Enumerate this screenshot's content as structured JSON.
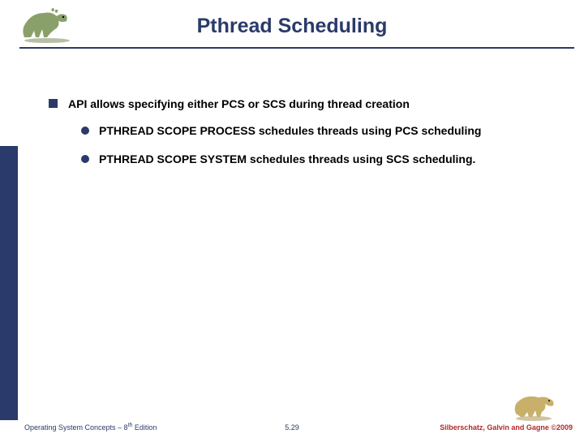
{
  "title": "Pthread Scheduling",
  "bullets": {
    "main": "API allows specifying either PCS or SCS during thread creation",
    "sub1": "PTHREAD SCOPE PROCESS schedules threads using PCS scheduling",
    "sub2": "PTHREAD SCOPE SYSTEM schedules threads using SCS scheduling."
  },
  "footer": {
    "left_a": "Operating System Concepts – 8",
    "left_sup": "th",
    "left_b": " Edition",
    "center": "5.29",
    "right": "Silberschatz, Galvin and Gagne ©2009"
  },
  "dino_top_colors": {
    "body": "#8aa06a",
    "shadow": "#6b7d4f"
  },
  "dino_bottom_colors": {
    "body": "#c9b06a",
    "shadow": "#a38a45"
  }
}
